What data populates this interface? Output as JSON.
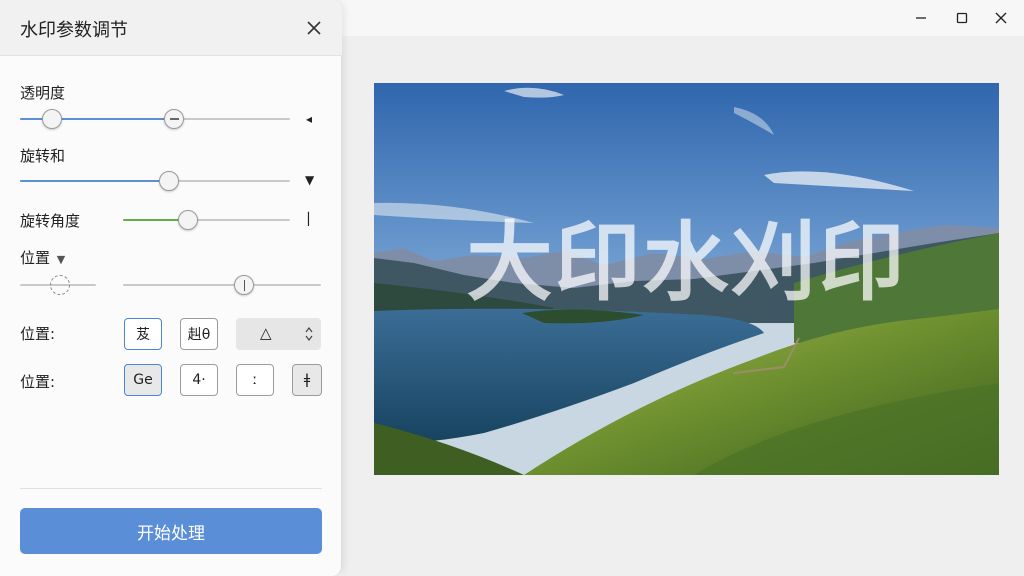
{
  "window": {
    "controls": [
      "minimize",
      "maximize",
      "close"
    ]
  },
  "panel": {
    "title": "水印参数调节",
    "sliders": [
      {
        "label": "透明度",
        "value_a": 0.12,
        "value_b": 0.57,
        "accent": "#5b8fd6",
        "end_mark": "◂"
      },
      {
        "label": "旋转和",
        "value": 0.55,
        "accent": "#5b8fd6",
        "end_mark": "▼"
      },
      {
        "label": "旋转角度",
        "value": 0.39,
        "accent": "#5fb04a",
        "end_mark": "▏"
      }
    ],
    "position_dropdown": {
      "label": "位置",
      "arrow": "▼",
      "small_value": 0.52,
      "large_value": 0.61
    },
    "row1": {
      "label": "位置:",
      "buttons": [
        "芨",
        "赳θ"
      ],
      "spinner_glyph": "△"
    },
    "row2": {
      "label": "位置:",
      "buttons": [
        "Ge",
        "4·",
        "ː",
        "ǂ"
      ]
    },
    "start_button": "开始处理"
  },
  "preview": {
    "watermark_text": "大印水刈印"
  },
  "colors": {
    "accent_blue": "#5a8fd8",
    "accent_green": "#5fb04a"
  }
}
